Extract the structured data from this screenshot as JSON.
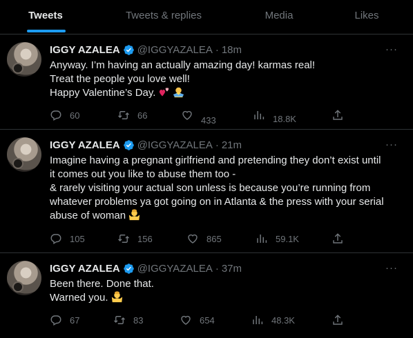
{
  "tabs": [
    {
      "label": "Tweets",
      "active": true
    },
    {
      "label": "Tweets & replies",
      "active": false
    },
    {
      "label": "Media",
      "active": false
    },
    {
      "label": "Likes",
      "active": false
    }
  ],
  "colors": {
    "accent": "#1d9bf0",
    "muted": "#71767b",
    "text": "#e7e9ea",
    "border": "#2f3336",
    "background": "#000000"
  },
  "tweets": [
    {
      "name": "IGGY AZALEA",
      "handle": "@IGGYAZALEA",
      "dot": "·",
      "time": "18m",
      "lines": [
        "Anyway. I’m having an actually amazing day! karmas real!",
        "Treat the people you love well!",
        "Happy Valentine’s Day."
      ],
      "replies": "60",
      "retweets": "66",
      "likes": "433",
      "views": "18.8K"
    },
    {
      "name": "IGGY AZALEA",
      "handle": "@IGGYAZALEA",
      "dot": "·",
      "time": "21m",
      "lines": [
        "Imagine having a pregnant girlfriend and pretending they don’t exist until",
        "it comes out you like to abuse them too -",
        "& rarely visiting your actual son unless is because you’re running from",
        "whatever problems ya got going on in Atlanta & the press with your serial",
        "abuse of woman"
      ],
      "replies": "105",
      "retweets": "156",
      "likes": "865",
      "views": "59.1K"
    },
    {
      "name": "IGGY AZALEA",
      "handle": "@IGGYAZALEA",
      "dot": "·",
      "time": "37m",
      "lines": [
        "Been there. Done that.",
        "Warned you."
      ],
      "replies": "67",
      "retweets": "83",
      "likes": "654",
      "views": "48.3K"
    }
  ],
  "more_label": "···"
}
